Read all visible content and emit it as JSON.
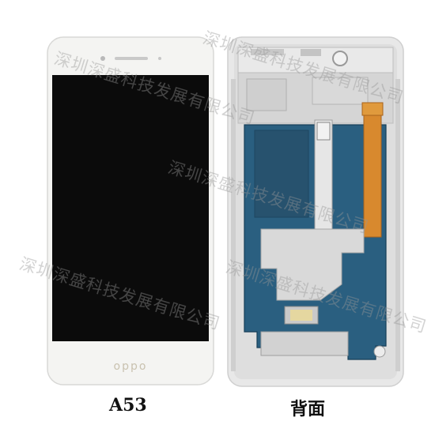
{
  "photo": {
    "front": {
      "brand_logo": "oppo"
    },
    "watermarks": [
      "深圳深盛科技发展有限公司",
      "深圳深盛科技发展有限公司",
      "深圳深盛科技发展有限公司",
      "深圳深盛科技发展有限公司",
      "深圳深盛科技发展有限公司"
    ]
  },
  "captions": {
    "front": "A53",
    "back": "背面"
  },
  "colors": {
    "phone_body": "#f4f4f2",
    "screen": "#0b0b0b",
    "frame_metal": "#e8e8e8",
    "shield_blue": "#2a5f80",
    "flex_orange": "#d8892e"
  }
}
